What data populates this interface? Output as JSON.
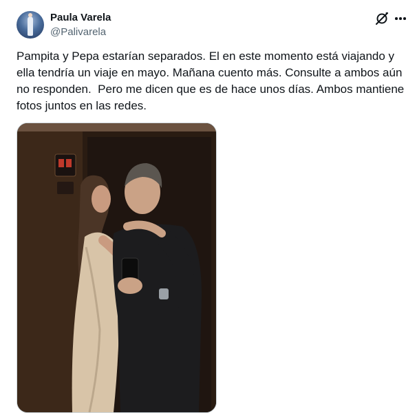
{
  "author": {
    "name": "Paula Varela",
    "handle": "@Palivarela"
  },
  "header": {
    "grok_icon": "grok-icon",
    "more_icon": "more-icon"
  },
  "tweet": {
    "text": "Pampita y Pepa estarían separados. El en este momento está viajando y ella tendría un viaje en mayo. Mañana cuento más. Consulte a ambos aún no responden.  Pero me dicen que es de hace unos días. Ambos mantiene fotos juntos en las redes."
  },
  "media": {
    "description_icon": "photo"
  },
  "colors": {
    "text": "#0f1419",
    "secondary": "#536471",
    "border": "#cfd9de"
  }
}
